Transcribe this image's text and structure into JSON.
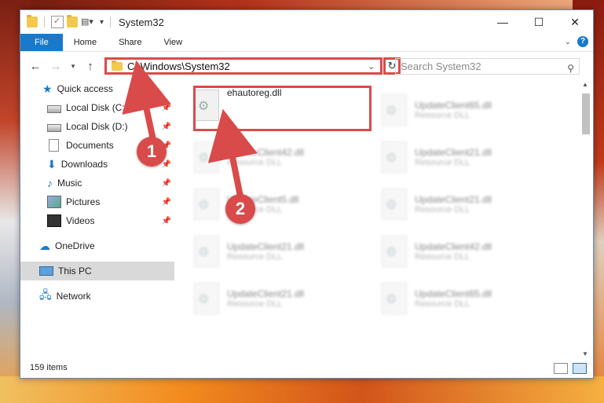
{
  "window": {
    "title": "System32",
    "minimize_glyph": "—",
    "maximize_glyph": "☐",
    "close_glyph": "✕"
  },
  "ribbon": {
    "tabs": [
      "File",
      "Home",
      "Share",
      "View"
    ],
    "help_label": "?"
  },
  "address": {
    "path": "C:\\Windows\\System32",
    "search_placeholder": "Search System32"
  },
  "sidebar": {
    "quick_access": "Quick access",
    "items": [
      {
        "label": "Local Disk (C:)",
        "icon": "drive-icon"
      },
      {
        "label": "Local Disk (D:)",
        "icon": "drive-icon"
      },
      {
        "label": "Documents",
        "icon": "documents-icon"
      },
      {
        "label": "Downloads",
        "icon": "downloads-icon"
      },
      {
        "label": "Music",
        "icon": "music-icon"
      },
      {
        "label": "Pictures",
        "icon": "pictures-icon"
      },
      {
        "label": "Videos",
        "icon": "videos-icon"
      }
    ],
    "onedrive": "OneDrive",
    "this_pc": "This PC",
    "network": "Network"
  },
  "files": [
    {
      "name": "ehautoreg.dll",
      "type": ""
    },
    {
      "name": "UpdateClient65.dll",
      "type": "Resource DLL"
    },
    {
      "name": "UpdateClient42.dll",
      "type": "Resource DLL"
    },
    {
      "name": "UpdateClient21.dll",
      "type": "Resource DLL"
    },
    {
      "name": "UpdateClient5.dll",
      "type": "Resource DLL"
    },
    {
      "name": "UpdateClient21.dll",
      "type": "Resource DLL"
    },
    {
      "name": "UpdateClient21.dll",
      "type": "Resource DLL"
    },
    {
      "name": "UpdateClient42.dll",
      "type": "Resource DLL"
    },
    {
      "name": "UpdateClient21.dll",
      "type": "Resource DLL"
    },
    {
      "name": "UpdateClient65.dll",
      "type": "Resource DLL"
    }
  ],
  "status": {
    "item_count": "159 items"
  },
  "markers": {
    "step1": "1",
    "step2": "2"
  },
  "colors": {
    "accent": "#1979ca",
    "highlight": "#d94b4b"
  }
}
